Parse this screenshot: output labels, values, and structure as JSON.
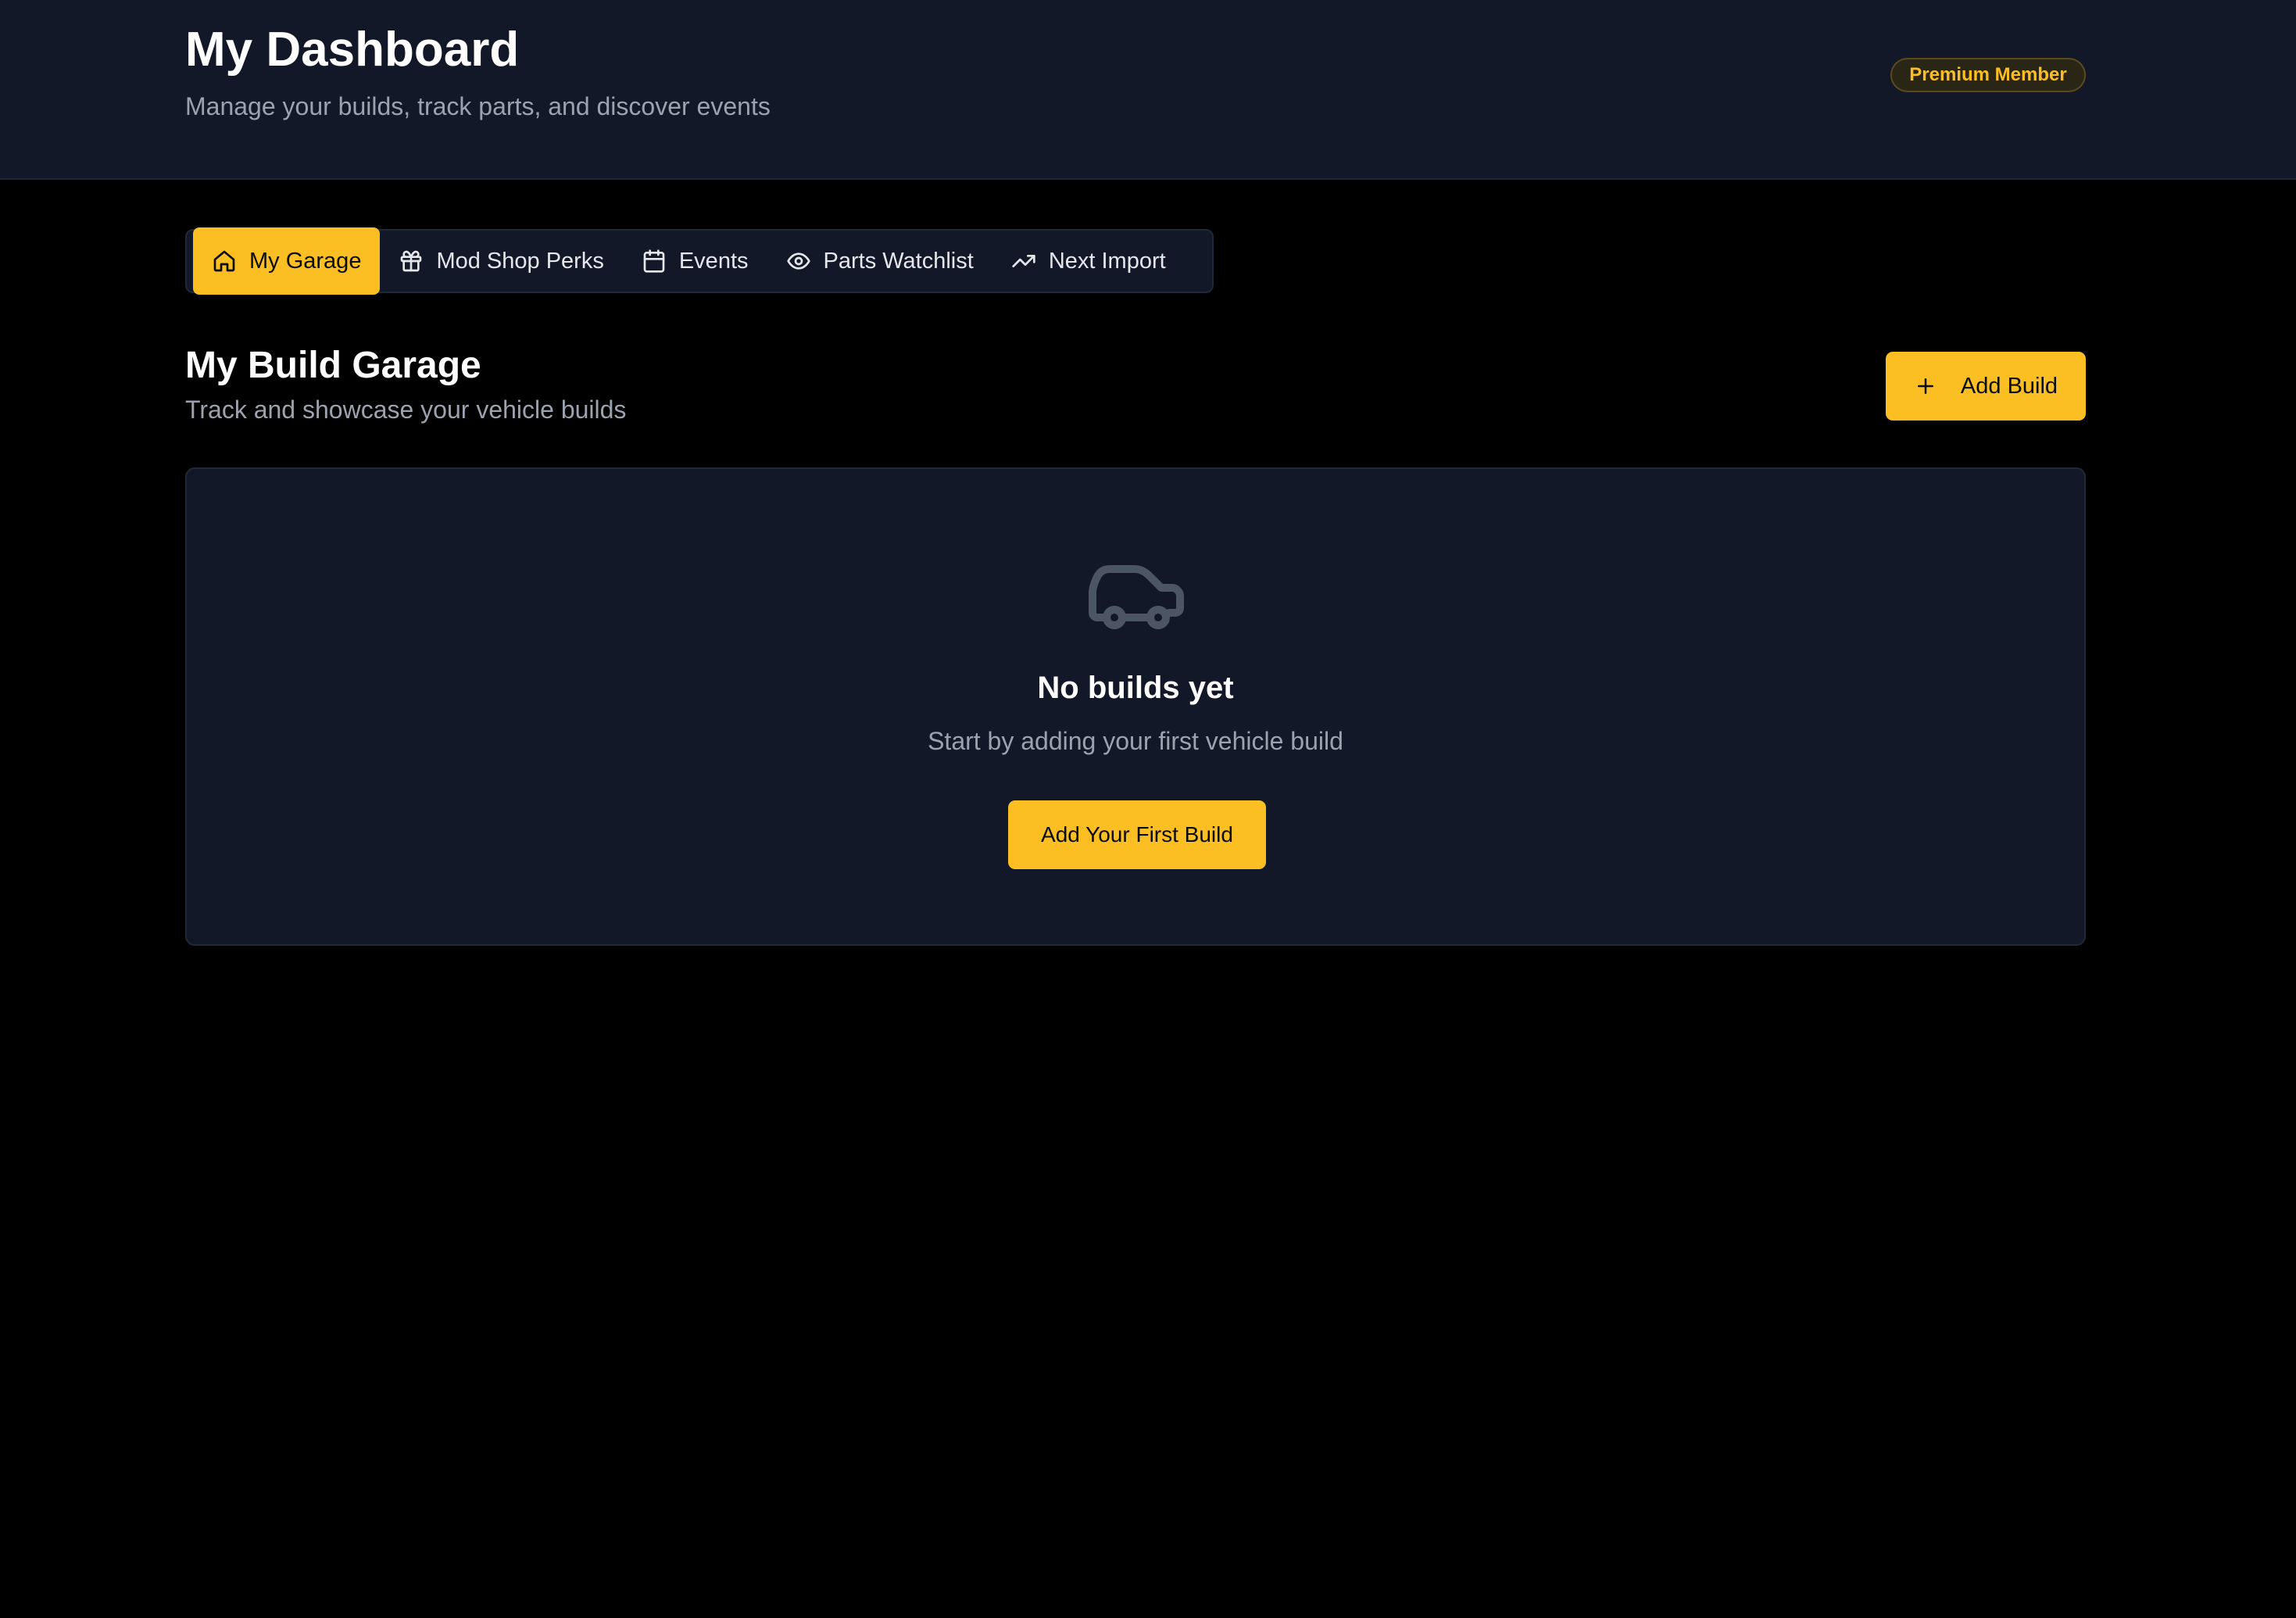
{
  "header": {
    "title": "My Dashboard",
    "subtitle": "Manage your builds, track parts, and discover events",
    "badge": "Premium Member"
  },
  "tabs": [
    {
      "label": "My Garage",
      "icon": "home-icon",
      "active": true
    },
    {
      "label": "Mod Shop Perks",
      "icon": "gift-icon",
      "active": false
    },
    {
      "label": "Events",
      "icon": "calendar-icon",
      "active": false
    },
    {
      "label": "Parts Watchlist",
      "icon": "eye-icon",
      "active": false
    },
    {
      "label": "Next Import",
      "icon": "trending-up-icon",
      "active": false
    }
  ],
  "garage": {
    "title": "My Build Garage",
    "subtitle": "Track and showcase your vehicle builds",
    "add_button": "Add Build",
    "add_icon": "plus-icon"
  },
  "empty_state": {
    "icon": "car-icon",
    "title": "No builds yet",
    "message": "Start by adding your first vehicle build",
    "button": "Add Your First Build"
  },
  "colors": {
    "accent": "#fbbf24",
    "panel": "#121827",
    "background": "#000000",
    "muted_text": "#9ca3af"
  }
}
